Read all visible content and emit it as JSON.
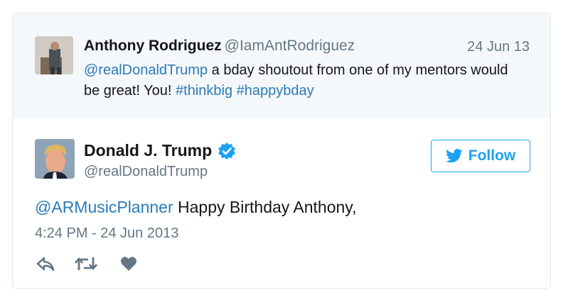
{
  "quoted_tweet": {
    "author_name": "Anthony Rodriguez",
    "author_handle": "@IamAntRodriguez",
    "date": "24 Jun 13",
    "mention": "@realDonaldTrump",
    "text": " a bday shoutout from one of my mentors would be great! You! ",
    "hashtag_1": "#thinkbig",
    "hashtag_2": "#happybday"
  },
  "main_tweet": {
    "author_name": "Donald J. Trump",
    "author_handle": "@realDonaldTrump",
    "verified": true,
    "follow_label": "Follow",
    "mention": "@ARMusicPlanner",
    "text": " Happy Birthday Anthony,",
    "timestamp": "4:24 PM - 24 Jun 2013"
  },
  "actions": {
    "icons": [
      "reply-icon",
      "retweet-icon",
      "heart-icon"
    ]
  },
  "colors": {
    "link": "#2b7bb9",
    "follow_blue": "#1da1f2",
    "muted": "#657786",
    "quoted_bg": "#f5f8fa",
    "border": "#e1e8ed"
  }
}
